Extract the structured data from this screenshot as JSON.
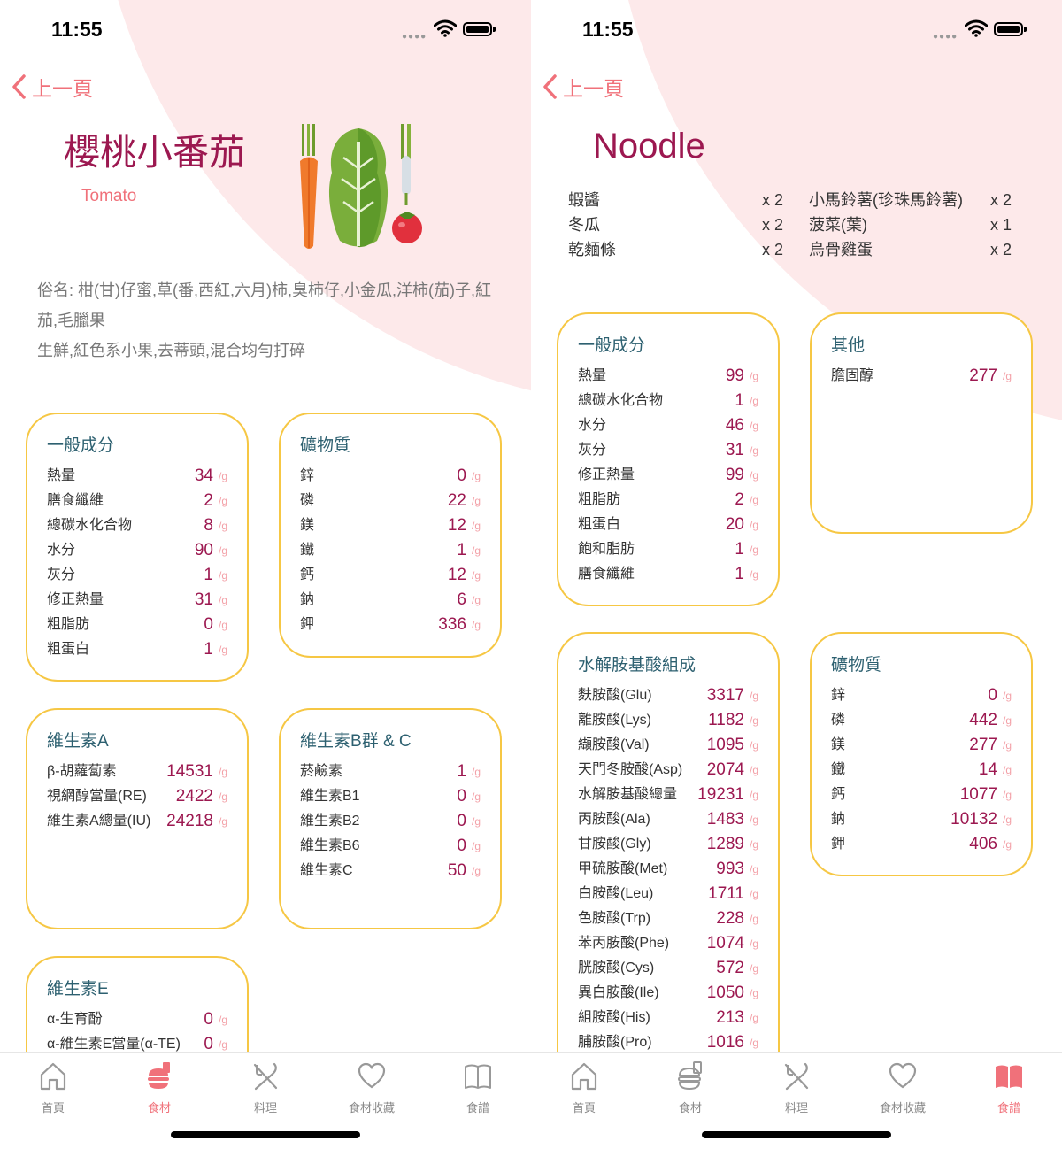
{
  "left_screen": {
    "status": {
      "time": "11:55"
    },
    "back_label": "上一頁",
    "food": {
      "name": "櫻桃小番茄",
      "english_name": "Tomato",
      "aliases": "俗名: 柑(甘)仔蜜,草(番,西紅,六月)柿,臭柿仔,小金瓜,洋柿(茄)子,紅茄,毛臘果",
      "description": "生鮮,紅色系小果,去蒂頭,混合均勻打碎"
    },
    "cards": [
      {
        "title": "一般成分",
        "rows": [
          {
            "label": "熱量",
            "value": "34",
            "unit": "/g"
          },
          {
            "label": "膳食纖維",
            "value": "2",
            "unit": "/g"
          },
          {
            "label": "總碳水化合物",
            "value": "8",
            "unit": "/g"
          },
          {
            "label": "水分",
            "value": "90",
            "unit": "/g"
          },
          {
            "label": "灰分",
            "value": "1",
            "unit": "/g"
          },
          {
            "label": "修正熱量",
            "value": "31",
            "unit": "/g"
          },
          {
            "label": "粗脂肪",
            "value": "0",
            "unit": "/g"
          },
          {
            "label": "粗蛋白",
            "value": "1",
            "unit": "/g"
          }
        ]
      },
      {
        "title": "礦物質",
        "rows": [
          {
            "label": "鋅",
            "value": "0",
            "unit": "/g"
          },
          {
            "label": "磷",
            "value": "22",
            "unit": "/g"
          },
          {
            "label": "鎂",
            "value": "12",
            "unit": "/g"
          },
          {
            "label": "鐵",
            "value": "1",
            "unit": "/g"
          },
          {
            "label": "鈣",
            "value": "12",
            "unit": "/g"
          },
          {
            "label": "鈉",
            "value": "6",
            "unit": "/g"
          },
          {
            "label": "鉀",
            "value": "336",
            "unit": "/g"
          }
        ]
      },
      {
        "title": "維生素A",
        "rows": [
          {
            "label": "β-胡蘿蔔素",
            "value": "14531",
            "unit": "/g"
          },
          {
            "label": "視網醇當量(RE)",
            "value": "2422",
            "unit": "/g"
          },
          {
            "label": "維生素A總量(IU)",
            "value": "24218",
            "unit": "/g"
          }
        ]
      },
      {
        "title": "維生素B群 & C",
        "rows": [
          {
            "label": "菸鹼素",
            "value": "1",
            "unit": "/g"
          },
          {
            "label": "維生素B1",
            "value": "0",
            "unit": "/g"
          },
          {
            "label": "維生素B2",
            "value": "0",
            "unit": "/g"
          },
          {
            "label": "維生素B6",
            "value": "0",
            "unit": "/g"
          },
          {
            "label": "維生素C",
            "value": "50",
            "unit": "/g"
          }
        ]
      },
      {
        "title": "維生素E",
        "rows": [
          {
            "label": "α-生育酚",
            "value": "0",
            "unit": "/g"
          },
          {
            "label": "α-維生素E當量(α-TE)",
            "value": "0",
            "unit": "/g"
          }
        ]
      }
    ],
    "tabs": [
      {
        "label": "首頁",
        "icon": "home-icon",
        "active": false
      },
      {
        "label": "食材",
        "icon": "food-icon",
        "active": true
      },
      {
        "label": "料理",
        "icon": "utensils-icon",
        "active": false
      },
      {
        "label": "食材收藏",
        "icon": "heart-icon",
        "active": false
      },
      {
        "label": "食譜",
        "icon": "book-icon",
        "active": false
      }
    ]
  },
  "right_screen": {
    "status": {
      "time": "11:55"
    },
    "back_label": "上一頁",
    "recipe": {
      "name": "Noodle",
      "ingredients_left": [
        {
          "name": "蝦醬",
          "qty": "x 2"
        },
        {
          "name": "冬瓜",
          "qty": "x 2"
        },
        {
          "name": "乾麵條",
          "qty": "x 2"
        }
      ],
      "ingredients_right": [
        {
          "name": "小馬鈴薯(珍珠馬鈴薯)",
          "qty": "x 2"
        },
        {
          "name": "菠菜(葉)",
          "qty": "x 1"
        },
        {
          "name": "烏骨雞蛋",
          "qty": "x 2"
        }
      ]
    },
    "cards": [
      {
        "title": "一般成分",
        "rows": [
          {
            "label": "熱量",
            "value": "99",
            "unit": "/g"
          },
          {
            "label": "總碳水化合物",
            "value": "1",
            "unit": "/g"
          },
          {
            "label": "水分",
            "value": "46",
            "unit": "/g"
          },
          {
            "label": "灰分",
            "value": "31",
            "unit": "/g"
          },
          {
            "label": "修正熱量",
            "value": "99",
            "unit": "/g"
          },
          {
            "label": "粗脂肪",
            "value": "2",
            "unit": "/g"
          },
          {
            "label": "粗蛋白",
            "value": "20",
            "unit": "/g"
          },
          {
            "label": "飽和脂肪",
            "value": "1",
            "unit": "/g"
          },
          {
            "label": "膳食纖維",
            "value": "1",
            "unit": "/g"
          }
        ]
      },
      {
        "title": "其他",
        "rows": [
          {
            "label": "膽固醇",
            "value": "277",
            "unit": "/g"
          }
        ]
      },
      {
        "title": "水解胺基酸組成",
        "rows": [
          {
            "label": "麩胺酸(Glu)",
            "value": "3317",
            "unit": "/g"
          },
          {
            "label": "離胺酸(Lys)",
            "value": "1182",
            "unit": "/g"
          },
          {
            "label": "纈胺酸(Val)",
            "value": "1095",
            "unit": "/g"
          },
          {
            "label": "天門冬胺酸(Asp)",
            "value": "2074",
            "unit": "/g"
          },
          {
            "label": "水解胺基酸總量",
            "value": "19231",
            "unit": "/g"
          },
          {
            "label": "丙胺酸(Ala)",
            "value": "1483",
            "unit": "/g"
          },
          {
            "label": "甘胺酸(Gly)",
            "value": "1289",
            "unit": "/g"
          },
          {
            "label": "甲硫胺酸(Met)",
            "value": "993",
            "unit": "/g"
          },
          {
            "label": "白胺酸(Leu)",
            "value": "1711",
            "unit": "/g"
          },
          {
            "label": "色胺酸(Trp)",
            "value": "228",
            "unit": "/g"
          },
          {
            "label": "苯丙胺酸(Phe)",
            "value": "1074",
            "unit": "/g"
          },
          {
            "label": "胱胺酸(Cys)",
            "value": "572",
            "unit": "/g"
          },
          {
            "label": "異白胺酸(Ile)",
            "value": "1050",
            "unit": "/g"
          },
          {
            "label": "組胺酸(His)",
            "value": "213",
            "unit": "/g"
          },
          {
            "label": "脯胺酸(Pro)",
            "value": "1016",
            "unit": "/g"
          }
        ]
      },
      {
        "title": "礦物質",
        "rows": [
          {
            "label": "鋅",
            "value": "0",
            "unit": "/g"
          },
          {
            "label": "磷",
            "value": "442",
            "unit": "/g"
          },
          {
            "label": "鎂",
            "value": "277",
            "unit": "/g"
          },
          {
            "label": "鐵",
            "value": "14",
            "unit": "/g"
          },
          {
            "label": "鈣",
            "value": "1077",
            "unit": "/g"
          },
          {
            "label": "鈉",
            "value": "10132",
            "unit": "/g"
          },
          {
            "label": "鉀",
            "value": "406",
            "unit": "/g"
          }
        ]
      }
    ],
    "tabs": [
      {
        "label": "首頁",
        "icon": "home-icon",
        "active": false
      },
      {
        "label": "食材",
        "icon": "food-icon",
        "active": false
      },
      {
        "label": "料理",
        "icon": "utensils-icon",
        "active": false
      },
      {
        "label": "食材收藏",
        "icon": "heart-icon",
        "active": false
      },
      {
        "label": "食譜",
        "icon": "book-icon",
        "active": true
      }
    ]
  }
}
